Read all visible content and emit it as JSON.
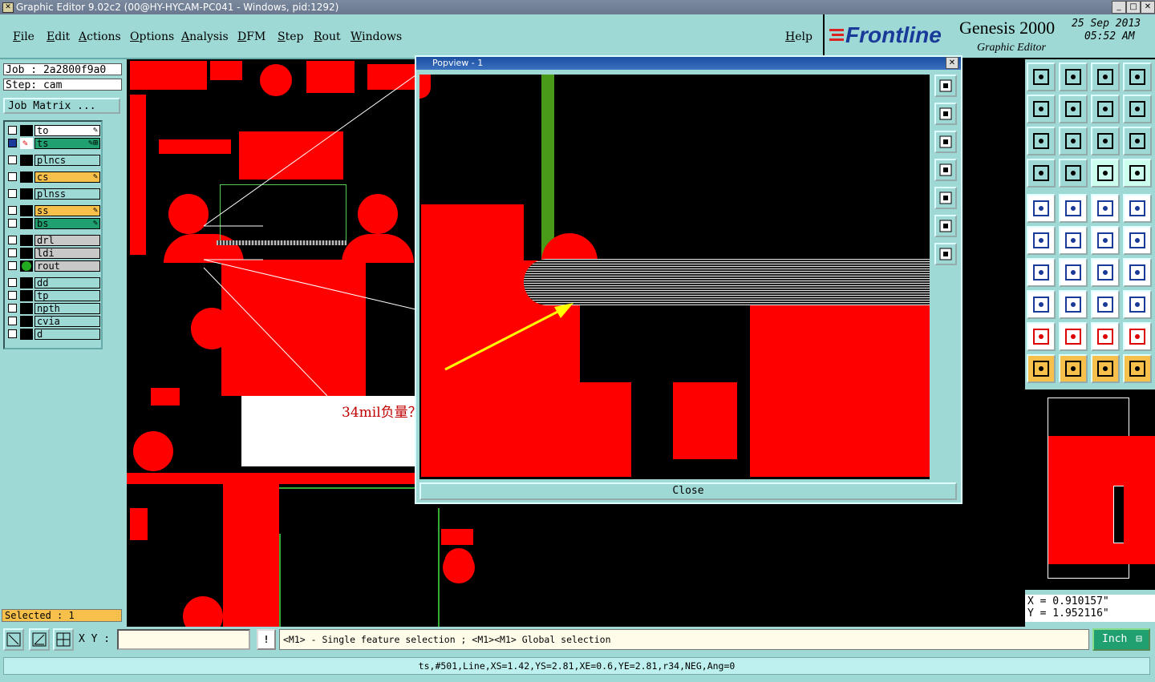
{
  "window": {
    "title": "Graphic Editor 9.02c2 (00@HY-HYCAM-PC041 - Windows, pid:1292)",
    "buttons": [
      "_",
      "□",
      "✕"
    ]
  },
  "menu": [
    "File",
    "Edit",
    "Actions",
    "Options",
    "Analysis",
    "DFM",
    "Step",
    "Rout",
    "Windows"
  ],
  "help_label": "Help",
  "brand": {
    "logo": "Frontline",
    "product": "Genesis 2000",
    "subtitle": "Graphic Editor",
    "date": "25 Sep 2013",
    "time": "05:52 AM"
  },
  "job": {
    "job_label": "Job : 2a2800f9a0",
    "step_label": "Step: cam",
    "matrix_button": "Job Matrix ..."
  },
  "layers": [
    {
      "name": "to",
      "color": "#ffffff",
      "marker": "✎"
    },
    {
      "name": "ts",
      "color": "#20a070",
      "marker": "✎⊞",
      "active": true
    },
    {
      "name": "plncs",
      "color": "#9ed9d5"
    },
    {
      "name": "cs",
      "color": "#f7c04a",
      "marker": "✎"
    },
    {
      "name": "plnss",
      "color": "#9ed9d5"
    },
    {
      "name": "ss",
      "color": "#f7c04a",
      "marker": "✎"
    },
    {
      "name": "bs",
      "color": "#20a070",
      "marker": "✎"
    },
    {
      "name": "drl",
      "color": "#c8c8c8"
    },
    {
      "name": "ldi",
      "color": "#c8c8c8"
    },
    {
      "name": "rout",
      "color": "#c8c8c8"
    },
    {
      "name": "dd",
      "color": "#9ed9d5"
    },
    {
      "name": "tp",
      "color": "#9ed9d5"
    },
    {
      "name": "npth",
      "color": "#9ed9d5"
    },
    {
      "name": "cvia",
      "color": "#9ed9d5"
    },
    {
      "name": "d",
      "color": "#9ed9d5"
    }
  ],
  "selected_label": "Selected : 1",
  "popview": {
    "title": "Popview - 1",
    "close_label": "Close"
  },
  "annotation_text": "34mil负量？",
  "coords": {
    "x": "X  =  0.910157\"",
    "y": "Y  =  1.952116\""
  },
  "bottom": {
    "xy_label": "X Y :",
    "xy_value": "",
    "bang": "!",
    "hint": "<M1> - Single feature selection ; <M1><M1> Global selection",
    "unit": "Inch"
  },
  "status": "ts,#501,Line,XS=1.42,YS=2.81,XE=0.6,YE=2.81,r34,NEG,Ang=0",
  "colors": {
    "panel": "#9ed9d5",
    "copper": "#ff0000",
    "active_layer": "#20a070",
    "highlight": "#f7c04a"
  },
  "icons": {
    "popview_side": [
      "zoom-window-icon",
      "pan-up-icon",
      "pan-down-icon",
      "pan-left-icon",
      "pan-right-icon",
      "zoom-fit-icon",
      "zoom-home-icon"
    ],
    "toolbar_rows": [
      [
        "zoom-up-icon",
        "zoom-down-icon",
        "home-icon",
        "split-window-icon"
      ],
      [
        "pan-left-icon",
        "pan-right-icon",
        "undo-icon",
        "redo-icon"
      ],
      [
        "zoom-in-icon",
        "zoom-out-icon",
        "scale-1-2-icon",
        "help-icon"
      ],
      [
        "tools-icon",
        "grid-icon",
        "snap-icon",
        "snap-alt-icon"
      ],
      [
        "select-feature-icon",
        "edit-shape-icon",
        "ruler-icon",
        "pad-icon"
      ],
      [
        "net-icon",
        "cross-icon",
        "connect-icon",
        "connect-alt-icon"
      ],
      [
        "line-icon",
        "draw-line-icon",
        "arc-icon",
        "text-icon"
      ],
      [
        "pad-add-icon",
        "trace-icon",
        "measure-icon",
        "cluster-icon"
      ],
      [
        "triangle-a-icon",
        "triangle-b-icon",
        "triangle-c-icon",
        "triangle-d-icon"
      ],
      [
        "pointer-icon",
        "pointer-box-icon",
        "pointer-alt-icon",
        "route-icon"
      ]
    ]
  }
}
